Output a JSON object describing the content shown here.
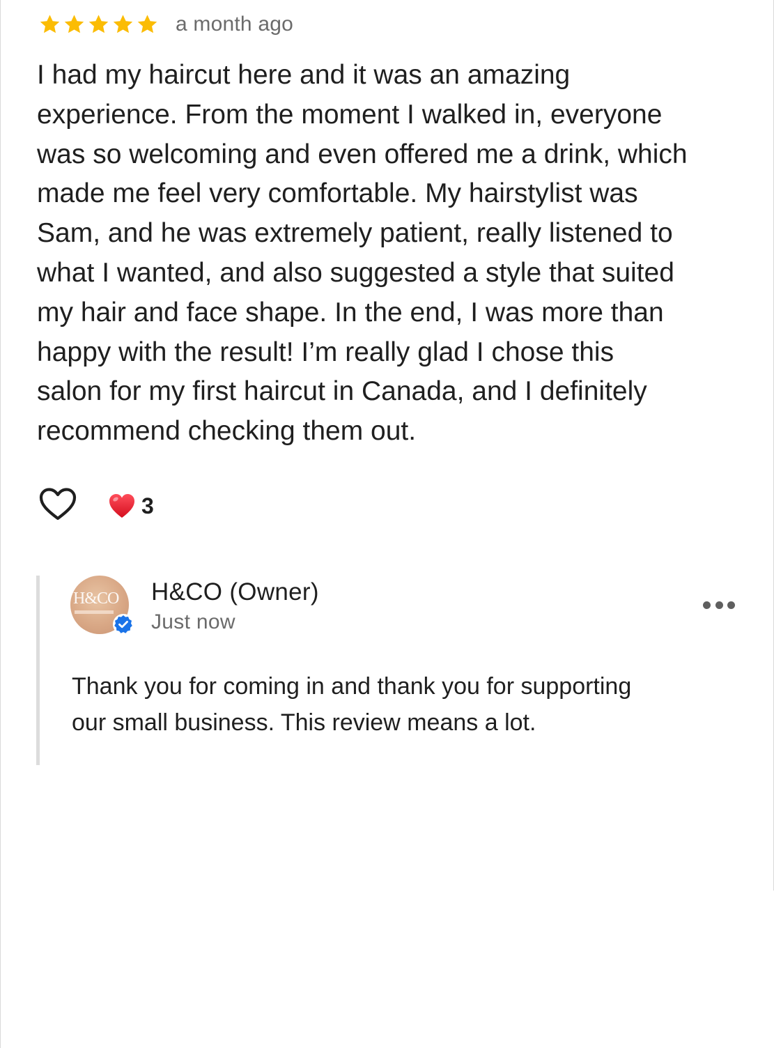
{
  "review": {
    "rating": 5,
    "rating_max": 5,
    "time_ago": "a month ago",
    "text_lines": [
      "I had my haircut here and it was an amazing",
      "experience. From the moment I walked in, everyone",
      "was so welcoming and even offered me a drink, which",
      "made me feel very comfortable. My hairstylist was",
      "Sam, and he was extremely patient, really listened to",
      "what I wanted, and also suggested a style that suited",
      "my hair and face shape. In the end, I was more than",
      "happy with the result! I’m really glad I chose this",
      "salon for my first haircut in Canada, and I definitely",
      "recommend checking them out."
    ]
  },
  "reactions": {
    "like_icon": "heart-outline-icon",
    "reaction_icon": "red-heart-icon",
    "count": "3"
  },
  "owner_reply": {
    "avatar_text": "H&CO",
    "name": "H&CO (Owner)",
    "time": "Just now",
    "verified_icon": "verified-check-icon",
    "more_icon": "more-horizontal-icon",
    "text_lines": [
      "Thank you for coming in and thank you for supporting",
      "our small business. This review means a lot."
    ]
  },
  "colors": {
    "star": "#fbbc04",
    "heart_red": "#e81224",
    "verified_blue": "#1a73e8",
    "secondary_text": "#6b6b6b"
  }
}
